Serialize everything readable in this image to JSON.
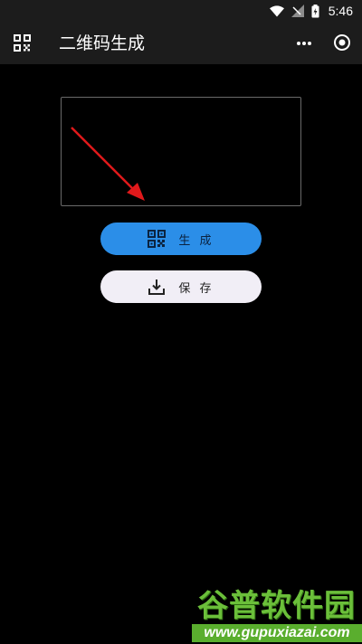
{
  "status_bar": {
    "time": "5:46",
    "icons": [
      "wifi-icon",
      "signal-icon",
      "battery-icon"
    ]
  },
  "app_bar": {
    "title": "二维码生成",
    "left_icon": "qr-code-icon",
    "right_icons": [
      "more-icon",
      "close-icon"
    ]
  },
  "buttons": {
    "generate_label": "生 成",
    "generate_icon": "qr-code-icon",
    "save_label": "保 存",
    "save_icon": "download-icon"
  },
  "annotation": {
    "arrow_color": "#e0191b"
  },
  "watermark": {
    "brand": "谷普软件园",
    "url": "www.gupuxiazai.com"
  },
  "colors": {
    "background": "#000000",
    "app_bar": "#1c1c1c",
    "primary_button": "#2b8ee8",
    "secondary_button": "#f1eef6",
    "watermark_green": "#6bbf3a"
  }
}
